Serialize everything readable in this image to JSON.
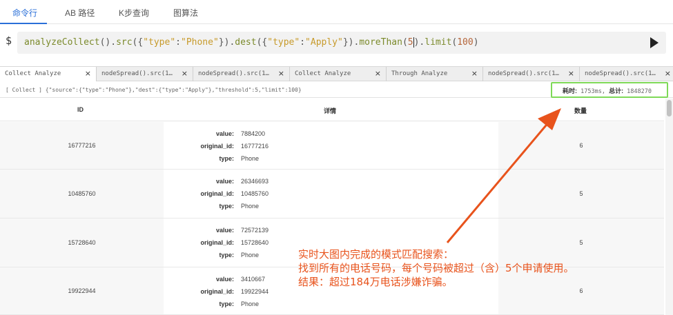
{
  "top_tabs": [
    "命令行",
    "AB 路径",
    "K步查询",
    "图算法"
  ],
  "command": {
    "prompt": "$",
    "tokens": [
      {
        "t": "analyzeCollect",
        "c": "fn"
      },
      {
        "t": "().",
        "c": "p"
      },
      {
        "t": "src",
        "c": "fn"
      },
      {
        "t": "({",
        "c": "p"
      },
      {
        "t": "\"type\"",
        "c": "str"
      },
      {
        "t": ":",
        "c": "p"
      },
      {
        "t": "\"Phone\"",
        "c": "str"
      },
      {
        "t": "}).",
        "c": "p"
      },
      {
        "t": "dest",
        "c": "fn"
      },
      {
        "t": "({",
        "c": "p"
      },
      {
        "t": "\"type\"",
        "c": "str"
      },
      {
        "t": ":",
        "c": "p"
      },
      {
        "t": "\"Apply\"",
        "c": "str"
      },
      {
        "t": "}).",
        "c": "p"
      },
      {
        "t": "moreThan",
        "c": "fn"
      },
      {
        "t": "(",
        "c": "p"
      },
      {
        "t": "5",
        "c": "num"
      },
      {
        "t": "|",
        "c": "cursor"
      },
      {
        "t": ").",
        "c": "p"
      },
      {
        "t": "limit",
        "c": "fn"
      },
      {
        "t": "(",
        "c": "p"
      },
      {
        "t": "100",
        "c": "num"
      },
      {
        "t": ")",
        "c": "p"
      }
    ],
    "run_icon": "play-icon"
  },
  "query_tabs": [
    {
      "label": "Collect Analyze",
      "active": true
    },
    {
      "label": "nodeSpread().src(1…",
      "active": false
    },
    {
      "label": "nodeSpread().src(1…",
      "active": false
    },
    {
      "label": "Collect Analyze",
      "active": false
    },
    {
      "label": "Through Analyze",
      "active": false
    },
    {
      "label": "nodeSpread().src(1…",
      "active": false
    },
    {
      "label": "nodeSpread().src(1…",
      "active": false
    }
  ],
  "close_glyph": "×",
  "info": {
    "query": "[ Collect ] {\"source\":{\"type\":\"Phone\"},\"dest\":{\"type\":\"Apply\"},\"threshold\":5,\"limit\":100}",
    "time_label": "耗时:",
    "time_value": " 1753ms, ",
    "total_label": "总计:",
    "total_value": " 1848270"
  },
  "table": {
    "headers": {
      "id": "ID",
      "detail": "详情",
      "count": "数量"
    },
    "rows": [
      {
        "id": "16777216",
        "value": "7884200",
        "original_id": "16777216",
        "type": "Phone",
        "count": "6"
      },
      {
        "id": "10485760",
        "value": "26346693",
        "original_id": "10485760",
        "type": "Phone",
        "count": "5"
      },
      {
        "id": "15728640",
        "value": "72572139",
        "original_id": "15728640",
        "type": "Phone",
        "count": "5"
      },
      {
        "id": "19922944",
        "value": "3410667",
        "original_id": "19922944",
        "type": "Phone",
        "count": "6"
      }
    ],
    "keys": {
      "value": "value:",
      "original_id": "original_id:",
      "type": "type:"
    }
  },
  "annotation": {
    "line1": "实时大图内完成的模式匹配搜索：",
    "line2": "找到所有的电话号码，每个号码被超过（含）5个申请使用。",
    "line3": "结果：超过184万电话涉嫌诈骗。",
    "color": "#e8531c"
  }
}
